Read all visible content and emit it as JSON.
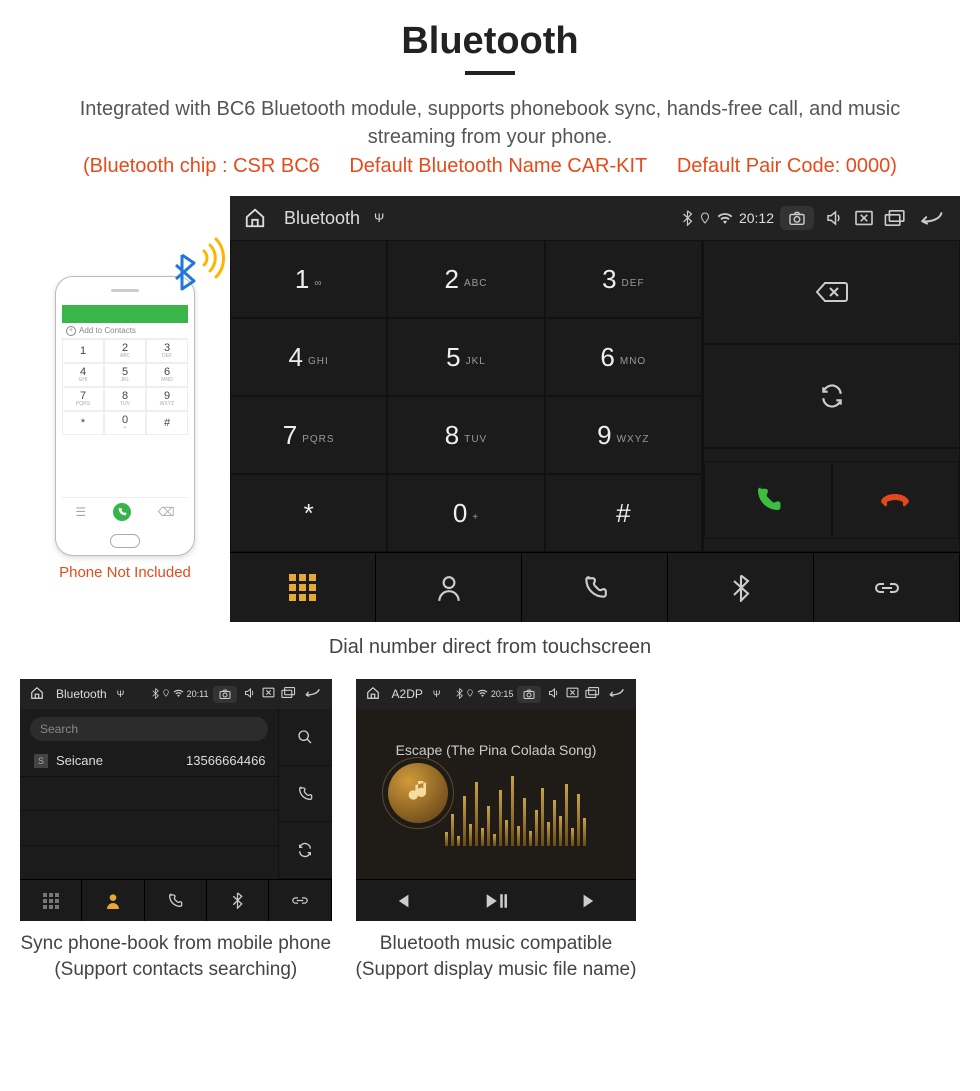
{
  "title": "Bluetooth",
  "desc": "Integrated with BC6 Bluetooth module, supports phonebook sync, hands-free call, and music streaming from your phone.",
  "spec_chip": "(Bluetooth chip : CSR BC6",
  "spec_name": "Default Bluetooth Name CAR-KIT",
  "spec_code": "Default Pair Code: 0000)",
  "phone_not_included": "Phone Not Included",
  "phone_add_contacts": "Add to Contacts",
  "caption_main": "Dial number direct from touchscreen",
  "statusbar_main": {
    "app": "Bluetooth",
    "time": "20:12"
  },
  "keypad": [
    {
      "n": "1",
      "sub": "∞"
    },
    {
      "n": "2",
      "sub": "ABC"
    },
    {
      "n": "3",
      "sub": "DEF"
    },
    {
      "n": "4",
      "sub": "GHI"
    },
    {
      "n": "5",
      "sub": "JKL"
    },
    {
      "n": "6",
      "sub": "MNO"
    },
    {
      "n": "7",
      "sub": "PQRS"
    },
    {
      "n": "8",
      "sub": "TUV"
    },
    {
      "n": "9",
      "sub": "WXYZ"
    },
    {
      "n": "*",
      "sub": ""
    },
    {
      "n": "0",
      "sub": "+"
    },
    {
      "n": "#",
      "sub": ""
    }
  ],
  "contacts_screen": {
    "statusbar": {
      "app": "Bluetooth",
      "time": "20:11"
    },
    "search_placeholder": "Search",
    "contact": {
      "letter": "S",
      "name": "Seicane",
      "number": "13566664466"
    },
    "caption_l1": "Sync phone-book from mobile phone",
    "caption_l2": "(Support contacts searching)"
  },
  "music_screen": {
    "statusbar": {
      "app": "A2DP",
      "time": "20:15"
    },
    "track": "Escape (The Pina Colada Song)",
    "caption_l1": "Bluetooth music compatible",
    "caption_l2": "(Support display music file name)"
  },
  "phone_keys": [
    {
      "n": "1",
      "l": ""
    },
    {
      "n": "2",
      "l": "ABC"
    },
    {
      "n": "3",
      "l": "DEF"
    },
    {
      "n": "4",
      "l": "GHI"
    },
    {
      "n": "5",
      "l": "JKL"
    },
    {
      "n": "6",
      "l": "MNO"
    },
    {
      "n": "7",
      "l": "PQRS"
    },
    {
      "n": "8",
      "l": "TUV"
    },
    {
      "n": "9",
      "l": "WXYZ"
    },
    {
      "n": "*",
      "l": ""
    },
    {
      "n": "0",
      "l": "+"
    },
    {
      "n": "#",
      "l": ""
    }
  ],
  "viz_bars": [
    14,
    32,
    10,
    50,
    22,
    64,
    18,
    40,
    12,
    56,
    26,
    70,
    20,
    48,
    15,
    36,
    58,
    24,
    46,
    30,
    62,
    18,
    52,
    28
  ]
}
